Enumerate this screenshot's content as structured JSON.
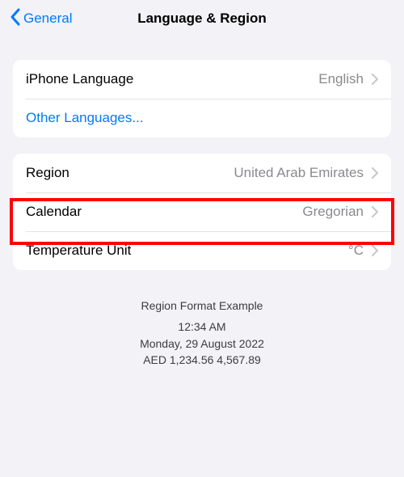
{
  "header": {
    "back_label": "General",
    "title": "Language & Region"
  },
  "group1": {
    "language_label": "iPhone Language",
    "language_value": "English",
    "other_languages_label": "Other Languages..."
  },
  "group2": {
    "region_label": "Region",
    "region_value": "United Arab Emirates",
    "calendar_label": "Calendar",
    "calendar_value": "Gregorian",
    "temp_label": "Temperature Unit",
    "temp_value": "°C"
  },
  "footer": {
    "heading": "Region Format Example",
    "time": "12:34 AM",
    "date": "Monday, 29 August 2022",
    "numbers": "AED 1,234.56   4,567.89"
  }
}
